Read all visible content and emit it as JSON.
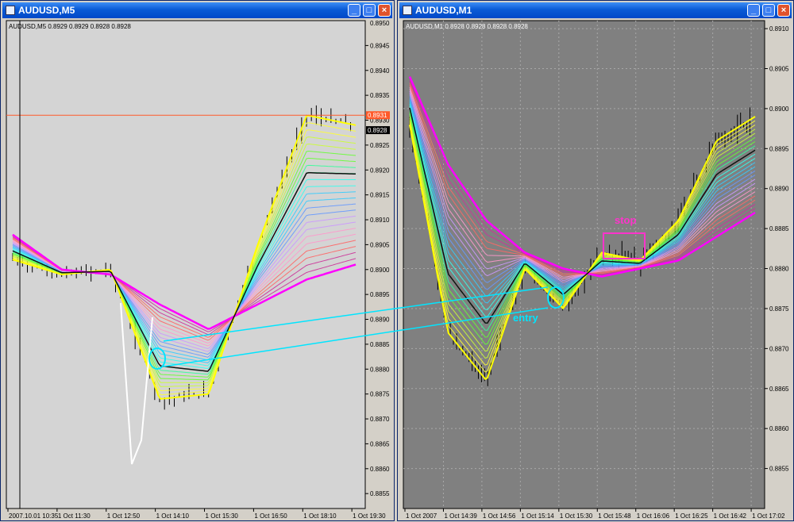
{
  "windows": [
    {
      "id": "left",
      "title": "AUDUSD,M5",
      "header": "AUDUSD,M5  0.8929 0.8929 0.8928 0.8928",
      "top_price_label": "0.8950",
      "price_labels": [
        "0.8945",
        "0.8940",
        "0.8935",
        "0.8930",
        "0.8925",
        "0.8920",
        "0.8915",
        "0.8910",
        "0.8905",
        "0.8900",
        "0.8895",
        "0.8890",
        "0.8885",
        "0.8880",
        "0.8875",
        "0.8870",
        "0.8865",
        "0.8860",
        "0.8855"
      ],
      "red_level_label": "0.8931",
      "bid_label": "0.8928",
      "time_labels": [
        "2007.10.01 10:35",
        "1 Oct 11:30",
        "1 Oct 12:50",
        "1 Oct 14:10",
        "1 Oct 15:30",
        "1 Oct 16:50",
        "1 Oct 18:10",
        "1 Oct 19:30"
      ],
      "background": "#d4d4d4",
      "buttons": {
        "minimize": "_",
        "maximize": "□",
        "close": "×"
      }
    },
    {
      "id": "right",
      "title": "AUDUSD,M1",
      "header": "AUDUSD,M1  0.8928 0.8928 0.8928 0.8928",
      "price_labels": [
        "0.8910",
        "0.8905",
        "0.8900",
        "0.8895",
        "0.8890",
        "0.8885",
        "0.8880",
        "0.8875",
        "0.8870",
        "0.8865",
        "0.8860",
        "0.8855"
      ],
      "time_labels": [
        "1 Oct 2007",
        "1 Oct 14:39",
        "1 Oct 14:56",
        "1 Oct 15:14",
        "1 Oct 15:30",
        "1 Oct 15:48",
        "1 Oct 16:06",
        "1 Oct 16:25",
        "1 Oct 16:42",
        "1 Oct 17:02"
      ],
      "background": "#808080",
      "buttons": {
        "minimize": "_",
        "maximize": "□",
        "close": "×"
      }
    }
  ],
  "annotations": {
    "stop": "stop",
    "entry": "entry"
  },
  "colors": {
    "ema_fast": "#ffff00",
    "ema_slow": "#ff00ff",
    "connector": "#00e5ff",
    "stop_box": "#ff33cc",
    "red_level": "#ff5a2a",
    "ribbon": [
      "#ffff33",
      "#ccff33",
      "#66ff33",
      "#33ff99",
      "#33ffee",
      "#33ccff",
      "#6699ff",
      "#cc99ff",
      "#ff99cc",
      "#ff6666",
      "#cc3399",
      "#9933ff"
    ]
  },
  "chart_data": [
    {
      "type": "line",
      "title": "AUDUSD,M5",
      "xlabel": "",
      "ylabel": "",
      "ylim": [
        0.8852,
        0.895
      ],
      "x": [
        "2007.10.01 10:35",
        "1 Oct 11:30",
        "1 Oct 12:50",
        "1 Oct 14:10",
        "1 Oct 15:30",
        "1 Oct 16:50",
        "1 Oct 18:10",
        "1 Oct 19:30"
      ],
      "series": [
        {
          "values": [
            0.8902,
            0.8899,
            0.89,
            0.8874,
            0.8875,
            0.8905,
            0.8931,
            0.8929
          ]
        },
        {
          "values": [
            0.8907,
            0.89,
            0.8899,
            0.8893,
            0.8888,
            0.8893,
            0.8898,
            0.8901
          ]
        }
      ]
    },
    {
      "type": "line",
      "title": "AUDUSD,M1",
      "xlabel": "",
      "ylabel": "",
      "ylim": [
        0.885,
        0.8911
      ],
      "x": [
        "1 Oct 2007",
        "1 Oct 14:39",
        "1 Oct 14:56",
        "1 Oct 15:14",
        "1 Oct 15:30",
        "1 Oct 15:48",
        "1 Oct 16:06",
        "1 Oct 16:25",
        "1 Oct 16:42",
        "1 Oct 17:02"
      ],
      "series": [
        {
          "values": [
            0.8898,
            0.8872,
            0.8866,
            0.888,
            0.8875,
            0.8882,
            0.8881,
            0.8886,
            0.8896,
            0.8899
          ]
        },
        {
          "values": [
            0.8904,
            0.8893,
            0.8886,
            0.8882,
            0.888,
            0.8879,
            0.888,
            0.8881,
            0.8884,
            0.8887
          ]
        }
      ]
    }
  ]
}
